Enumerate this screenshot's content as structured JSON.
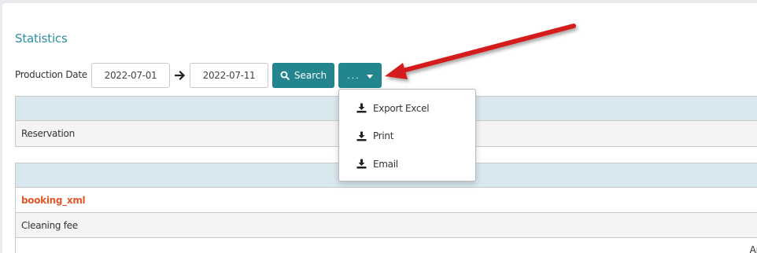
{
  "page": {
    "title": "Statistics"
  },
  "filter": {
    "date_label": "Production Date",
    "from_date": "2022-07-01",
    "to_date": "2022-07-11",
    "search_label": "Search",
    "more_label": "..."
  },
  "dropdown": {
    "items": [
      {
        "label": "Export Excel",
        "icon": "download-icon"
      },
      {
        "label": "Print",
        "icon": "download-icon"
      },
      {
        "label": "Email",
        "icon": "download-icon"
      }
    ]
  },
  "table1": {
    "rows": [
      "Reservation"
    ]
  },
  "table2": {
    "rows": [
      "booking_xml",
      "Cleaning fee"
    ],
    "cut_off_text": "Amo"
  },
  "colors": {
    "accent": "#23868f",
    "title": "#2a8fa0",
    "link": "#e0582a",
    "header_row": "#d9e7ef",
    "annotation_arrow": "#d41c1c"
  }
}
